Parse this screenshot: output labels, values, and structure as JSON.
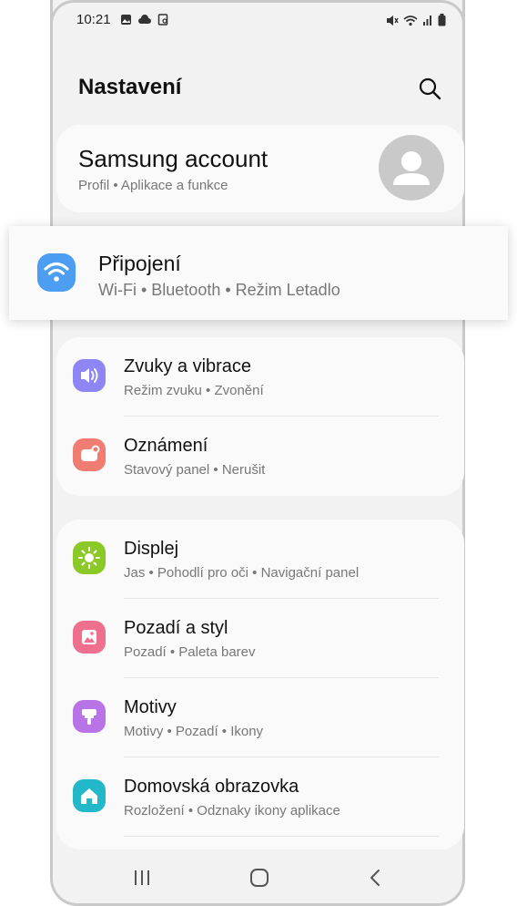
{
  "status_bar": {
    "time": "10:21",
    "left_icons": [
      "gallery-icon",
      "cloud-icon",
      "screenshot-icon"
    ],
    "right_icons": [
      "mute-icon",
      "wifi-icon",
      "signal-icon",
      "battery-icon"
    ]
  },
  "header": {
    "title": "Nastavení"
  },
  "account": {
    "name": "Samsung account",
    "sub": "Profil  •  Aplikace a funkce"
  },
  "connections": {
    "label": "Připojení",
    "sub": "Wi-Fi  •  Bluetooth  •  Režim Letadlo",
    "color": "#4d9df2"
  },
  "group1": [
    {
      "label": "Zvuky a vibrace",
      "sub": "Režim zvuku  •  Zvonění",
      "color": "#8e86f5",
      "icon": "volume-icon"
    },
    {
      "label": "Oznámení",
      "sub": "Stavový panel  •  Nerušit",
      "color": "#f07c72",
      "icon": "notification-icon"
    }
  ],
  "group2": [
    {
      "label": "Displej",
      "sub": "Jas  •  Pohodlí pro oči  •  Navigační panel",
      "color": "#8ac926",
      "icon": "sun-icon"
    },
    {
      "label": "Pozadí a styl",
      "sub": "Pozadí  •  Paleta barev",
      "color": "#ef6f8e",
      "icon": "wallpaper-icon"
    },
    {
      "label": "Motivy",
      "sub": "Motivy  •  Pozadí  •  Ikony",
      "color": "#b874e6",
      "icon": "brush-icon"
    },
    {
      "label": "Domovská obrazovka",
      "sub": "Rozložení  •  Odznaky ikony aplikace",
      "color": "#22b8c9",
      "icon": "home-icon"
    }
  ],
  "navbar": [
    "recents-icon",
    "home-button-icon",
    "back-icon"
  ]
}
